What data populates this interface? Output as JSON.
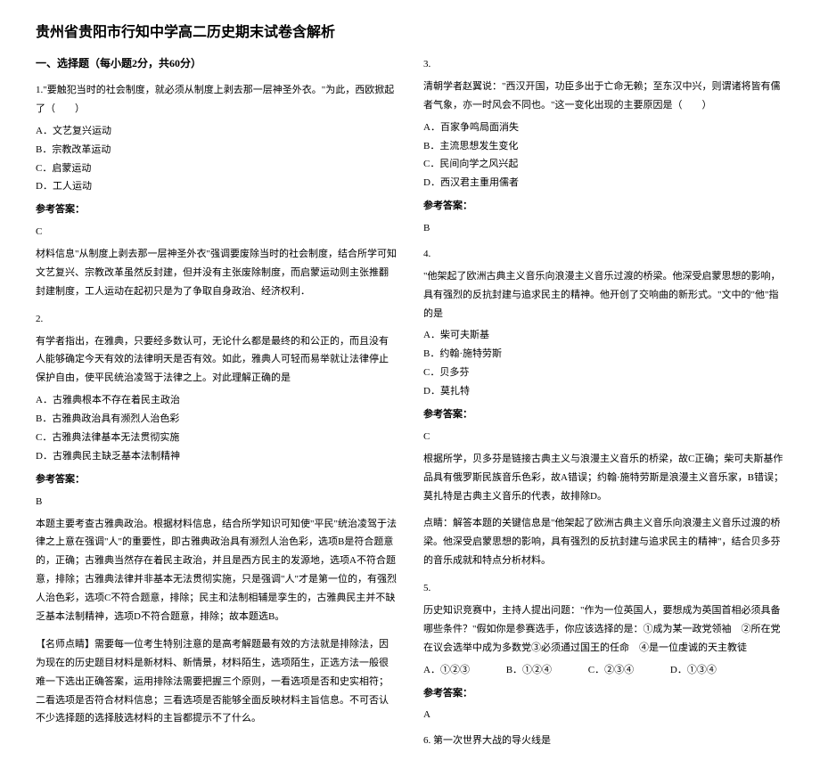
{
  "title": "贵州省贵阳市行知中学高二历史期末试卷含解析",
  "section1": "一、选择题（每小题2分，共60分）",
  "q1": {
    "stem": "1.\"要触犯当时的社会制度，就必须从制度上剥去那一层神圣外衣。\"为此，西欧掀起了（　　）",
    "a": "A．文艺复兴运动",
    "b": "B．宗教改革运动",
    "c": "C．启蒙运动",
    "d": "D．工人运动",
    "ans_label": "参考答案：",
    "ans": "C",
    "exp": "材料信息\"从制度上剥去那一层神圣外衣\"强调要废除当时的社会制度，结合所学可知文艺复兴、宗教改革虽然反封建，但并没有主张废除制度，而启蒙运动则主张推翻封建制度，工人运动在起初只是为了争取自身政治、经济权利．"
  },
  "q2": {
    "stem": "2.",
    "intro": "有学者指出，在雅典，只要经多数认可，无论什么都是最终的和公正的，而且没有人能够确定今天有效的法律明天是否有效。如此，雅典人可轻而易举就让法律停止保护自由，使平民统治凌驾于法律之上。对此理解正确的是",
    "a": "A．古雅典根本不存在着民主政治",
    "b": "B．古雅典政治具有濒烈人治色彩",
    "c": "C．古雅典法律基本无法贯彻实施",
    "d": "D．古雅典民主缺乏基本法制精神",
    "ans_label": "参考答案：",
    "ans": "B",
    "exp1": "本题主要考查古雅典政治。根据材料信息，结合所学知识可知使\"平民\"统治凌驾于法律之上意在强调\"人\"的重要性，即古雅典政治具有濒烈人治色彩，选项B是符合题意的，正确；古雅典当然存在着民主政治，并且是西方民主的发源地，选项A不符合题意，排除；古雅典法律并非基本无法贯彻实施，只是强调\"人\"才是第一位的，有强烈人治色彩，选项C不符合题意，排除；民主和法制相辅是孪生的，古雅典民主并不缺乏基本法制精神，选项D不符合题意，排除；故本题选B。",
    "exp2": "【名师点睛】需要每一位考生特别注意的是高考解题最有效的方法就是排除法，因为现在的历史题目材料是新材料、新情景，材料陌生，选项陌生，正选方法一般很难一下选出正确答案，运用排除法需要把握三个原则，一看选项是否和史实相符；二看选项是否符合材料信息；三看选项是否能够全面反映材料主旨信息。不可否认不少选择题的选择肢选材料的主旨都提示不了什么。"
  },
  "q3": {
    "stem": "3.",
    "intro": "清朝学者赵翼说：\"西汉开国，功臣多出于亡命无赖；至东汉中兴，则谓诸将皆有儒者气象，亦一时风会不同也。\"这一变化出现的主要原因是（　　）",
    "a": "A．百家争鸣局面消失",
    "b": "B．主流思想发生变化",
    "c": "C．民间向学之风兴起",
    "d": "D．西汉君主重用儒者",
    "ans_label": "参考答案：",
    "ans": "B"
  },
  "q4": {
    "stem": "4.",
    "intro": "\"他架起了欧洲古典主义音乐向浪漫主义音乐过渡的桥梁。他深受启蒙思想的影响，具有强烈的反抗封建与追求民主的精神。他开创了交响曲的新形式。\"文中的\"他\"指的是",
    "a": "A．柴可夫斯基",
    "b": "B．约翰·施特劳斯",
    "c": "C．贝多芬",
    "d": "D．莫扎特",
    "ans_label": "参考答案：",
    "ans": "C",
    "exp1": "根据所学，贝多芬是链接古典主义与浪漫主义音乐的桥梁，故C正确；柴可夫斯基作品具有俄罗斯民族音乐色彩，故A错误；约翰·施特劳斯是浪漫主义音乐家，B错误；莫扎特是古典主义音乐的代表，故排除D。",
    "exp2": "点睛：解答本题的关键信息是\"他架起了欧洲古典主义音乐向浪漫主义音乐过渡的桥梁。他深受启蒙思想的影响，具有强烈的反抗封建与追求民主的精神\"，结合贝多芬的音乐成就和特点分析材料。"
  },
  "q5": {
    "stem": "5.",
    "intro": "历史知识竞赛中，主持人提出问题：\"作为一位英国人，要想成为英国首相必须具备哪些条件？\"假如你是参赛选手，你应该选择的是：①成为某一政党领袖　②所在党在议会选举中成为多数党③必须通过国王的任命　④是一位虔诚的天主教徒",
    "opts": {
      "a": "A．①②③",
      "b": "B．①②④",
      "c": "C．②③④",
      "d": "D．①③④"
    },
    "ans_label": "参考答案：",
    "ans": "A"
  },
  "q6": {
    "stem": "6. 第一次世界大战的导火线是"
  }
}
